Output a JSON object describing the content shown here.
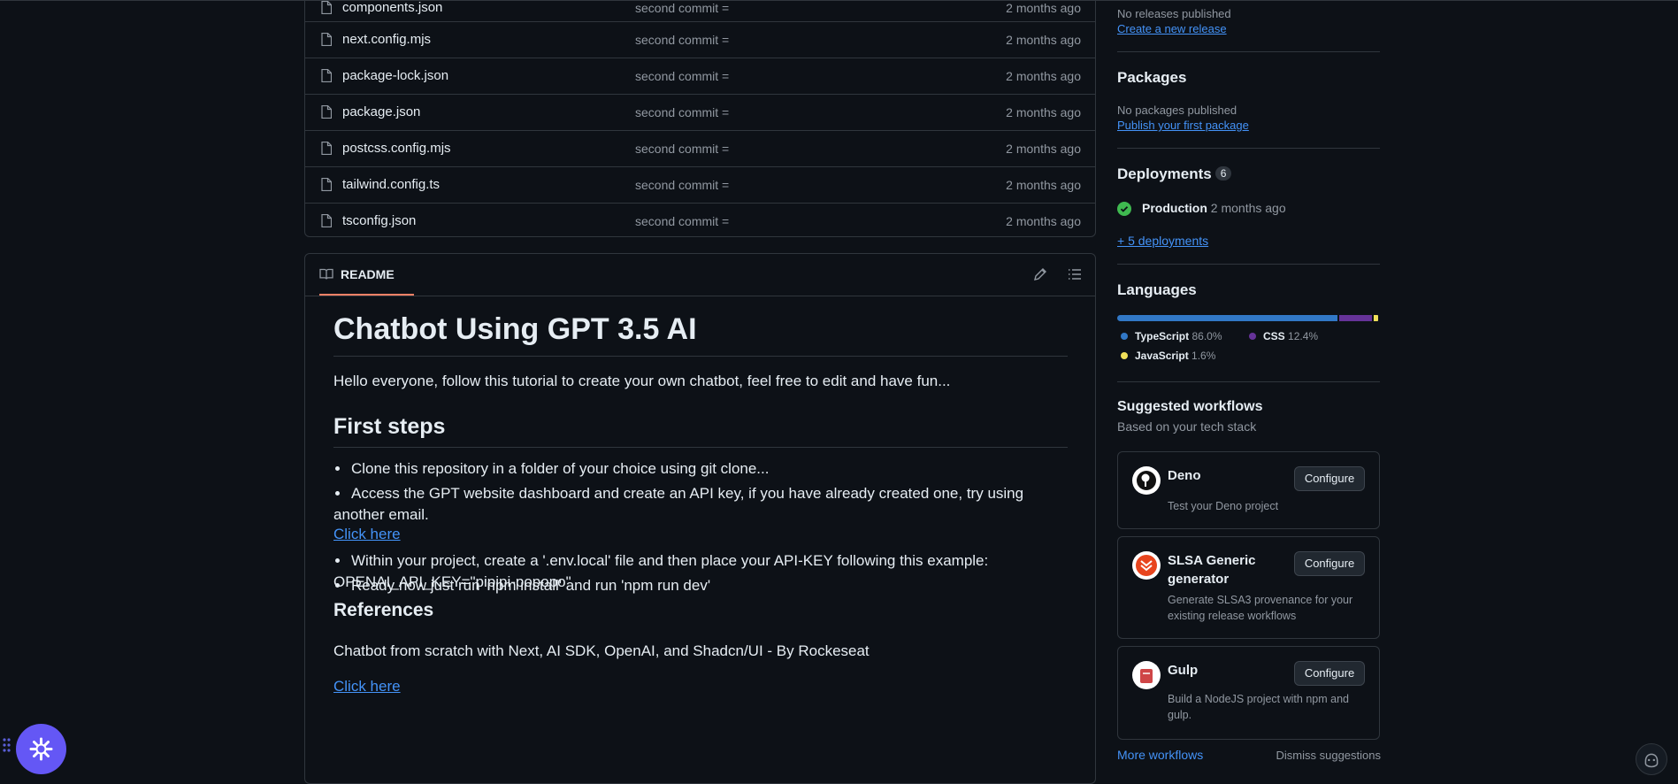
{
  "files": [
    {
      "name": "components.json",
      "commit": "second commit =",
      "date": "2 months ago"
    },
    {
      "name": "next.config.mjs",
      "commit": "second commit =",
      "date": "2 months ago"
    },
    {
      "name": "package-lock.json",
      "commit": "second commit =",
      "date": "2 months ago"
    },
    {
      "name": "package.json",
      "commit": "second commit =",
      "date": "2 months ago"
    },
    {
      "name": "postcss.config.mjs",
      "commit": "second commit =",
      "date": "2 months ago"
    },
    {
      "name": "tailwind.config.ts",
      "commit": "second commit =",
      "date": "2 months ago"
    },
    {
      "name": "tsconfig.json",
      "commit": "second commit =",
      "date": "2 months ago"
    }
  ],
  "readme": {
    "tab_label": "README",
    "title": "Chatbot Using GPT 3.5 AI",
    "intro": "Hello everyone, follow this tutorial to create your own chatbot, feel free to edit and have fun...",
    "first_steps_heading": "First steps",
    "step1": "Clone this repository in a folder of your choice using git clone...",
    "step2_line1": "Access the GPT website dashboard and create an API key, if you have already created one, try using",
    "step2_line2": "another email.",
    "click_here_1": "Click here",
    "step3_line1": "Within your project, create a '.env.local' file and then place your API-KEY following this example:",
    "step3_line2": "OPENAI_API_KEY=\"pipipi-popopo\"",
    "step4": "Ready now just run 'npm install' and run 'npm run dev'",
    "references_heading": "References",
    "references_text": "Chatbot from scratch with Next, AI SDK, OpenAI, and Shadcn/UI - By Rockeseat",
    "click_here_2": "Click here"
  },
  "sidebar": {
    "releases": {
      "empty": "No releases published",
      "link": "Create a new release"
    },
    "packages": {
      "heading": "Packages",
      "empty": "No packages published",
      "link": "Publish your first package"
    },
    "deployments": {
      "heading": "Deployments",
      "count": "6",
      "env": "Production",
      "time": "2 months ago",
      "more": "+ 5 deployments"
    },
    "languages": {
      "heading": "Languages",
      "items": [
        {
          "name": "TypeScript",
          "percent": "86.0%",
          "value": 86.0,
          "color": "#3178c6"
        },
        {
          "name": "CSS",
          "percent": "12.4%",
          "value": 12.4,
          "color": "#663399"
        },
        {
          "name": "JavaScript",
          "percent": "1.6%",
          "value": 1.6,
          "color": "#f1e05a"
        }
      ]
    },
    "workflows": {
      "heading": "Suggested workflows",
      "subheading": "Based on your tech stack",
      "items": [
        {
          "title": "Deno",
          "desc": "Test your Deno project",
          "button": "Configure"
        },
        {
          "title_line1": "SLSA Generic",
          "title_line2": "generator",
          "desc_line1": "Generate SLSA3 provenance for your",
          "desc_line2": "existing release workflows",
          "button": "Configure"
        },
        {
          "title": "Gulp",
          "desc_line1": "Build a NodeJS project with npm and",
          "desc_line2": "gulp.",
          "button": "Configure"
        }
      ],
      "more": "More workflows",
      "dismiss": "Dismiss suggestions"
    }
  },
  "colors": {
    "accent": "#4493f8",
    "success": "#3fb950",
    "tab_underline": "#f78166",
    "fab": "#6457f5"
  }
}
